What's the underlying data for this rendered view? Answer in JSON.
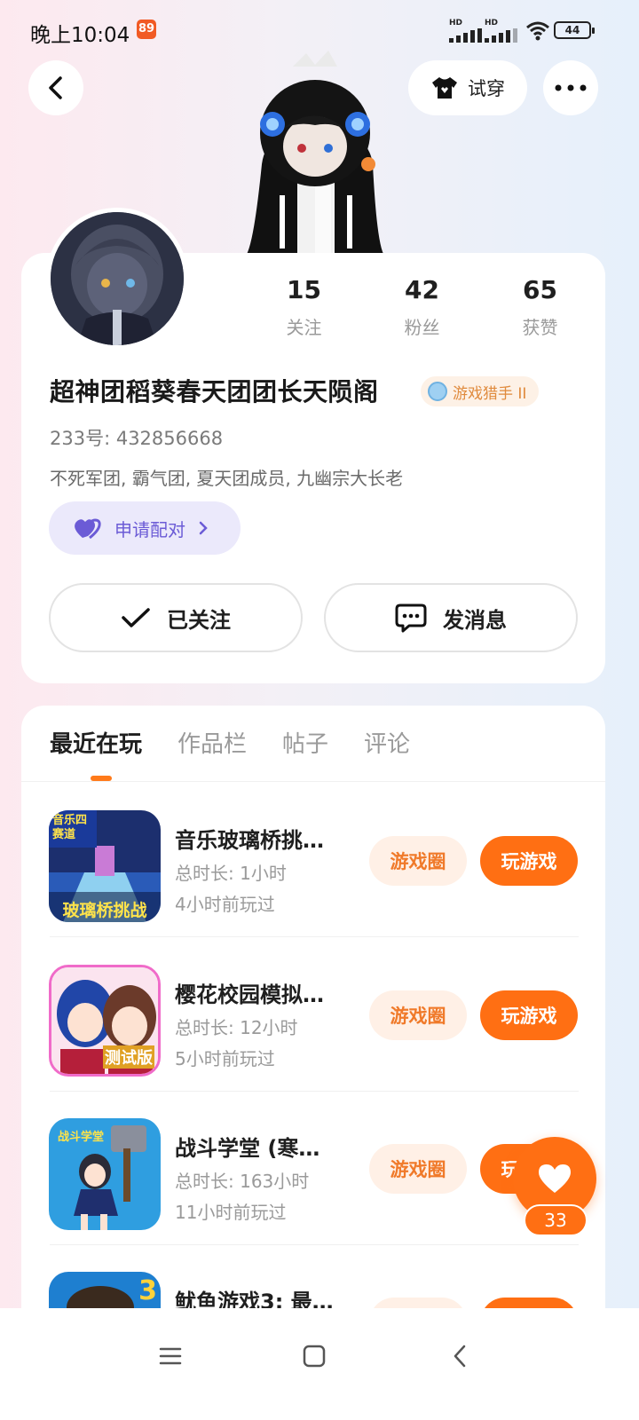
{
  "status_bar": {
    "time": "晚上10:04",
    "carrier_badge": "89",
    "signal_label_1": "HD",
    "signal_label_2": "HD",
    "battery": "44"
  },
  "header": {
    "try_on_label": "试穿",
    "back_icon": "chevron-left-icon",
    "more_icon": "more-dots-icon",
    "try_on_icon": "shirt-icon"
  },
  "profile": {
    "stats": [
      {
        "value": "15",
        "label": "关注"
      },
      {
        "value": "42",
        "label": "粉丝"
      },
      {
        "value": "65",
        "label": "获赞"
      }
    ],
    "username": "超神团稻葵春天团团长天陨阁",
    "level_badge": "游戏猎手 II",
    "user_id": "233号: 432856668",
    "bio": "不死军团, 霸气团, 夏天团成员, 九幽宗大长老",
    "pair_label": "申请配对",
    "follow_label": "已关注",
    "message_label": "发消息"
  },
  "tabs": [
    {
      "label": "最近在玩",
      "active": true
    },
    {
      "label": "作品栏",
      "active": false
    },
    {
      "label": "帖子",
      "active": false
    },
    {
      "label": "评论",
      "active": false
    }
  ],
  "games": [
    {
      "title": "音乐玻璃桥挑…",
      "duration": "总时长: 1小时",
      "last_played": "4小时前玩过",
      "circle_label": "游戏圈",
      "play_label": "玩游戏",
      "icon_text_top": "音乐四赛道",
      "icon_text_bottom": "玻璃桥挑战"
    },
    {
      "title": "樱花校园模拟…",
      "duration": "总时长: 12小时",
      "last_played": "5小时前玩过",
      "circle_label": "游戏圈",
      "play_label": "玩游戏",
      "icon_text_bottom": "测试版"
    },
    {
      "title": "战斗学堂 (寒…",
      "duration": "总时长: 163小时",
      "last_played": "11小时前玩过",
      "circle_label": "游戏圈",
      "play_label": "玩游戏",
      "icon_text_top": "战斗学堂"
    },
    {
      "title": "鱿鱼游戏3: 最…",
      "duration": "",
      "last_played": "",
      "circle_label": "",
      "play_label": "",
      "icon_text_top": "3"
    }
  ],
  "like": {
    "count": "33"
  },
  "colors": {
    "accent": "#ff6f13",
    "accent_light": "#fff0e6",
    "pair_bg": "#ebe9fb",
    "pair_text": "#6b5bd6"
  }
}
